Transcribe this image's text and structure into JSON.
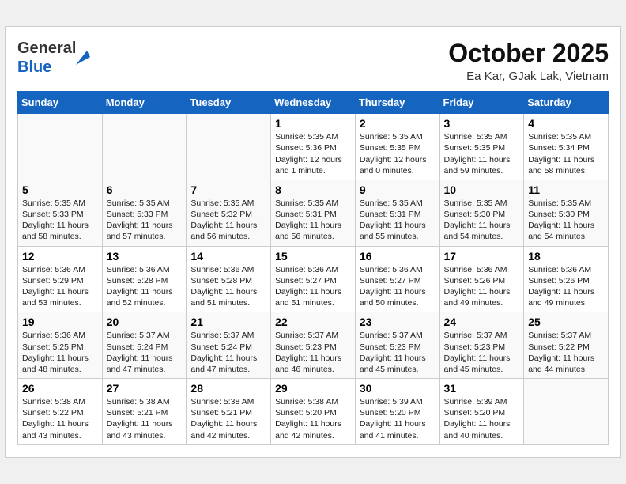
{
  "header": {
    "logo_line1": "General",
    "logo_line2": "Blue",
    "month": "October 2025",
    "location": "Ea Kar, GJak Lak, Vietnam"
  },
  "weekdays": [
    "Sunday",
    "Monday",
    "Tuesday",
    "Wednesday",
    "Thursday",
    "Friday",
    "Saturday"
  ],
  "weeks": [
    [
      {
        "day": "",
        "info": ""
      },
      {
        "day": "",
        "info": ""
      },
      {
        "day": "",
        "info": ""
      },
      {
        "day": "1",
        "info": "Sunrise: 5:35 AM\nSunset: 5:36 PM\nDaylight: 12 hours\nand 1 minute."
      },
      {
        "day": "2",
        "info": "Sunrise: 5:35 AM\nSunset: 5:35 PM\nDaylight: 12 hours\nand 0 minutes."
      },
      {
        "day": "3",
        "info": "Sunrise: 5:35 AM\nSunset: 5:35 PM\nDaylight: 11 hours\nand 59 minutes."
      },
      {
        "day": "4",
        "info": "Sunrise: 5:35 AM\nSunset: 5:34 PM\nDaylight: 11 hours\nand 58 minutes."
      }
    ],
    [
      {
        "day": "5",
        "info": "Sunrise: 5:35 AM\nSunset: 5:33 PM\nDaylight: 11 hours\nand 58 minutes."
      },
      {
        "day": "6",
        "info": "Sunrise: 5:35 AM\nSunset: 5:33 PM\nDaylight: 11 hours\nand 57 minutes."
      },
      {
        "day": "7",
        "info": "Sunrise: 5:35 AM\nSunset: 5:32 PM\nDaylight: 11 hours\nand 56 minutes."
      },
      {
        "day": "8",
        "info": "Sunrise: 5:35 AM\nSunset: 5:31 PM\nDaylight: 11 hours\nand 56 minutes."
      },
      {
        "day": "9",
        "info": "Sunrise: 5:35 AM\nSunset: 5:31 PM\nDaylight: 11 hours\nand 55 minutes."
      },
      {
        "day": "10",
        "info": "Sunrise: 5:35 AM\nSunset: 5:30 PM\nDaylight: 11 hours\nand 54 minutes."
      },
      {
        "day": "11",
        "info": "Sunrise: 5:35 AM\nSunset: 5:30 PM\nDaylight: 11 hours\nand 54 minutes."
      }
    ],
    [
      {
        "day": "12",
        "info": "Sunrise: 5:36 AM\nSunset: 5:29 PM\nDaylight: 11 hours\nand 53 minutes."
      },
      {
        "day": "13",
        "info": "Sunrise: 5:36 AM\nSunset: 5:28 PM\nDaylight: 11 hours\nand 52 minutes."
      },
      {
        "day": "14",
        "info": "Sunrise: 5:36 AM\nSunset: 5:28 PM\nDaylight: 11 hours\nand 51 minutes."
      },
      {
        "day": "15",
        "info": "Sunrise: 5:36 AM\nSunset: 5:27 PM\nDaylight: 11 hours\nand 51 minutes."
      },
      {
        "day": "16",
        "info": "Sunrise: 5:36 AM\nSunset: 5:27 PM\nDaylight: 11 hours\nand 50 minutes."
      },
      {
        "day": "17",
        "info": "Sunrise: 5:36 AM\nSunset: 5:26 PM\nDaylight: 11 hours\nand 49 minutes."
      },
      {
        "day": "18",
        "info": "Sunrise: 5:36 AM\nSunset: 5:26 PM\nDaylight: 11 hours\nand 49 minutes."
      }
    ],
    [
      {
        "day": "19",
        "info": "Sunrise: 5:36 AM\nSunset: 5:25 PM\nDaylight: 11 hours\nand 48 minutes."
      },
      {
        "day": "20",
        "info": "Sunrise: 5:37 AM\nSunset: 5:24 PM\nDaylight: 11 hours\nand 47 minutes."
      },
      {
        "day": "21",
        "info": "Sunrise: 5:37 AM\nSunset: 5:24 PM\nDaylight: 11 hours\nand 47 minutes."
      },
      {
        "day": "22",
        "info": "Sunrise: 5:37 AM\nSunset: 5:23 PM\nDaylight: 11 hours\nand 46 minutes."
      },
      {
        "day": "23",
        "info": "Sunrise: 5:37 AM\nSunset: 5:23 PM\nDaylight: 11 hours\nand 45 minutes."
      },
      {
        "day": "24",
        "info": "Sunrise: 5:37 AM\nSunset: 5:23 PM\nDaylight: 11 hours\nand 45 minutes."
      },
      {
        "day": "25",
        "info": "Sunrise: 5:37 AM\nSunset: 5:22 PM\nDaylight: 11 hours\nand 44 minutes."
      }
    ],
    [
      {
        "day": "26",
        "info": "Sunrise: 5:38 AM\nSunset: 5:22 PM\nDaylight: 11 hours\nand 43 minutes."
      },
      {
        "day": "27",
        "info": "Sunrise: 5:38 AM\nSunset: 5:21 PM\nDaylight: 11 hours\nand 43 minutes."
      },
      {
        "day": "28",
        "info": "Sunrise: 5:38 AM\nSunset: 5:21 PM\nDaylight: 11 hours\nand 42 minutes."
      },
      {
        "day": "29",
        "info": "Sunrise: 5:38 AM\nSunset: 5:20 PM\nDaylight: 11 hours\nand 42 minutes."
      },
      {
        "day": "30",
        "info": "Sunrise: 5:39 AM\nSunset: 5:20 PM\nDaylight: 11 hours\nand 41 minutes."
      },
      {
        "day": "31",
        "info": "Sunrise: 5:39 AM\nSunset: 5:20 PM\nDaylight: 11 hours\nand 40 minutes."
      },
      {
        "day": "",
        "info": ""
      }
    ]
  ]
}
